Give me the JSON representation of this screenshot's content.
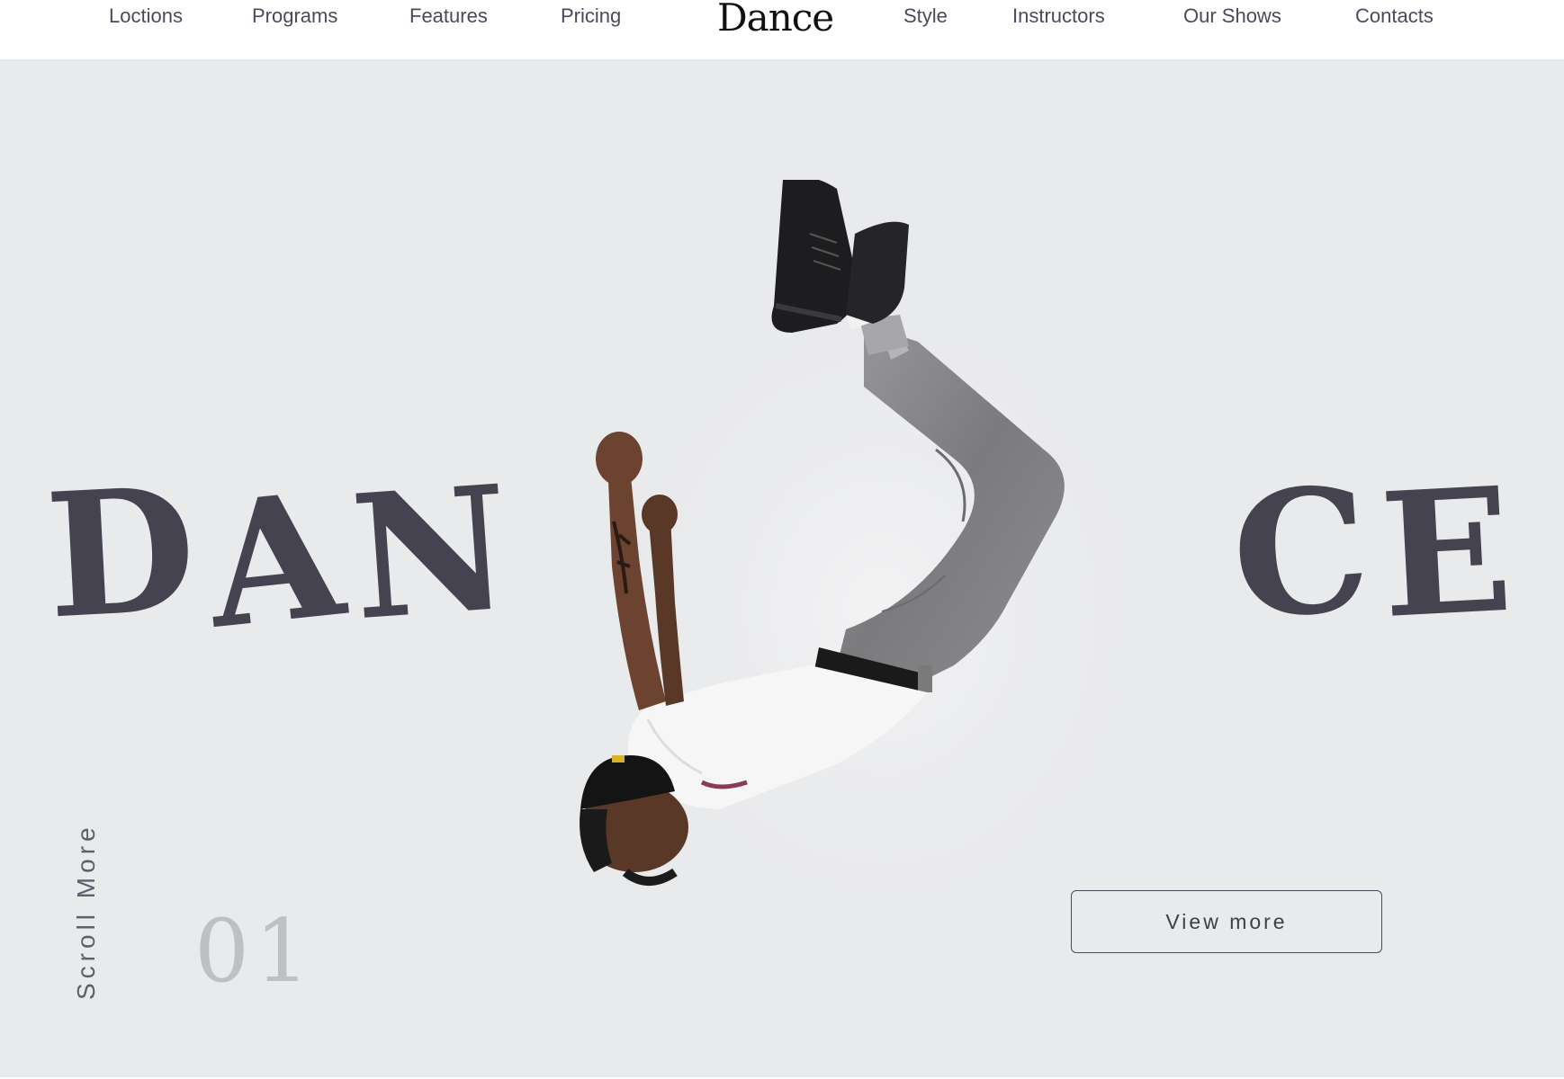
{
  "nav": {
    "left_links": [
      "Loctions",
      "Programs",
      "Features",
      "Pricing"
    ],
    "logo": "Dance",
    "right_links": [
      "Style",
      "Instructors",
      "Our Shows",
      "Contacts"
    ]
  },
  "hero": {
    "word_left": [
      "D",
      "A",
      "N"
    ],
    "word_right": [
      "C",
      "E"
    ],
    "scroll_label": "Scroll More",
    "slide_number": "01",
    "cta_label": "View more",
    "image_alt": "dancer-jumping-upside-down"
  },
  "colors": {
    "background": "#e9eaec",
    "headline": "#44434f",
    "nav_text": "#4a4b5a",
    "slide_number": "#bfc0c3"
  }
}
